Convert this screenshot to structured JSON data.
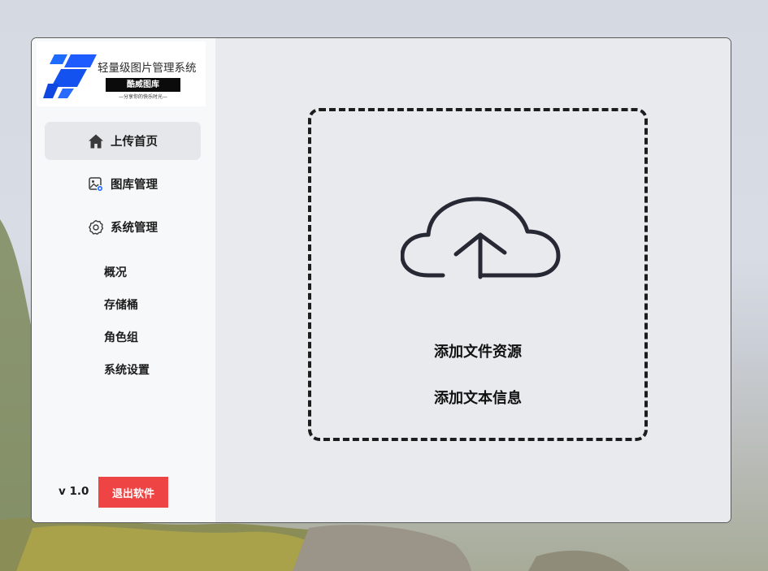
{
  "app": {
    "title": "轻量级图片管理系统",
    "badge": "酷威图库",
    "slogan": "—分享你的快乐时光—",
    "version": "v 1.0"
  },
  "sidebar": {
    "items": [
      {
        "label": "上传首页",
        "icon": "home-icon",
        "active": true
      },
      {
        "label": "图库管理",
        "icon": "gallery-icon",
        "active": false
      },
      {
        "label": "系统管理",
        "icon": "gear-icon",
        "active": false
      }
    ],
    "sub_items": [
      {
        "label": "概况"
      },
      {
        "label": "存储桶"
      },
      {
        "label": "角色组"
      },
      {
        "label": "系统设置"
      }
    ],
    "exit_label": "退出软件"
  },
  "upload": {
    "icon": "cloud-upload-icon",
    "add_file_label": "添加文件资源",
    "add_text_label": "添加文本信息"
  },
  "colors": {
    "exit_button": "#ef4444",
    "logo_blue": "#1f5cff",
    "sidebar_bg": "#f7f8fa",
    "main_bg": "#e9eaee"
  }
}
